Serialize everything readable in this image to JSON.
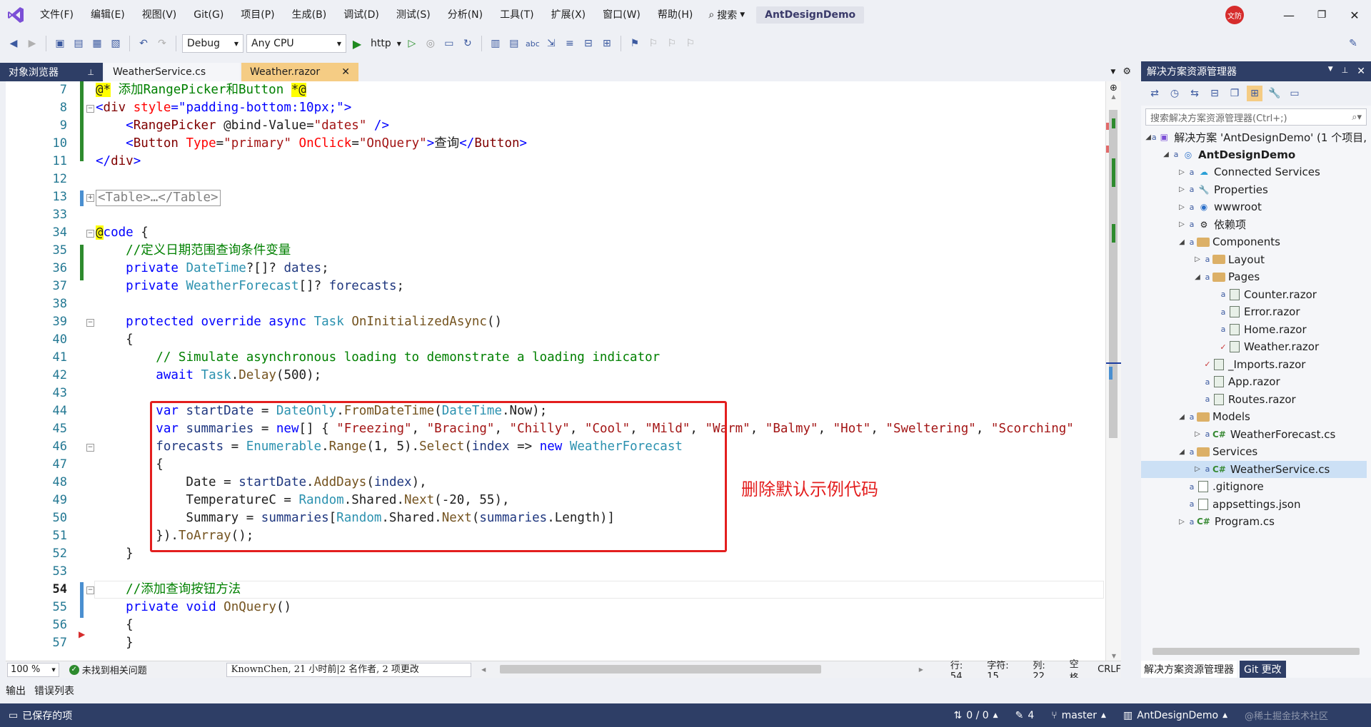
{
  "menu": {
    "items": [
      "文件(F)",
      "编辑(E)",
      "视图(V)",
      "Git(G)",
      "项目(P)",
      "生成(B)",
      "调试(D)",
      "测试(S)",
      "分析(N)",
      "工具(T)",
      "扩展(X)",
      "窗口(W)",
      "帮助(H)"
    ],
    "search_label": "搜索",
    "solution_title": "AntDesignDemo",
    "user_avatar": "文防"
  },
  "toolbar": {
    "config": "Debug",
    "platform": "Any CPU",
    "run_target": "http"
  },
  "tabs": {
    "object_browser": "对象浏览器",
    "file1": "WeatherService.cs",
    "file2": "Weather.razor"
  },
  "editor": {
    "line_numbers": [
      "7",
      "8",
      "9",
      "10",
      "11",
      "12",
      "13",
      "33",
      "34",
      "35",
      "36",
      "37",
      "38",
      "39",
      "40",
      "41",
      "42",
      "43",
      "44",
      "45",
      "46",
      "47",
      "48",
      "49",
      "50",
      "51",
      "52",
      "53",
      "54",
      "55",
      "56",
      "57"
    ],
    "current_line": "54",
    "annotation": "删除默认示例代码"
  },
  "status_line": {
    "zoom": "100 %",
    "issues": "未找到相关问题",
    "git_info": "KnownChen, 21 小时前|2 名作者, 2 项更改",
    "line": "行: 54",
    "char": "字符: 15",
    "col": "列: 22",
    "whitespace": "空格",
    "eol": "CRLF"
  },
  "solution_explorer": {
    "title": "解决方案资源管理器",
    "search_placeholder": "搜索解决方案资源管理器(Ctrl+;)",
    "items": [
      {
        "label": "解决方案 'AntDesignDemo' (1 个项目,",
        "indent": 0,
        "kind": "solution"
      },
      {
        "label": "AntDesignDemo",
        "indent": 1,
        "kind": "project"
      },
      {
        "label": "Connected Services",
        "indent": 2,
        "kind": "connected"
      },
      {
        "label": "Properties",
        "indent": 2,
        "kind": "props"
      },
      {
        "label": "wwwroot",
        "indent": 2,
        "kind": "globe"
      },
      {
        "label": "依赖项",
        "indent": 2,
        "kind": "deps"
      },
      {
        "label": "Components",
        "indent": 2,
        "kind": "folder"
      },
      {
        "label": "Layout",
        "indent": 3,
        "kind": "folder"
      },
      {
        "label": "Pages",
        "indent": 3,
        "kind": "folder"
      },
      {
        "label": "Counter.razor",
        "indent": 4,
        "kind": "razor"
      },
      {
        "label": "Error.razor",
        "indent": 4,
        "kind": "razor"
      },
      {
        "label": "Home.razor",
        "indent": 4,
        "kind": "razor"
      },
      {
        "label": "Weather.razor",
        "indent": 4,
        "kind": "razor"
      },
      {
        "label": "_Imports.razor",
        "indent": 3,
        "kind": "razor"
      },
      {
        "label": "App.razor",
        "indent": 3,
        "kind": "razor"
      },
      {
        "label": "Routes.razor",
        "indent": 3,
        "kind": "razor"
      },
      {
        "label": "Models",
        "indent": 2,
        "kind": "folder"
      },
      {
        "label": "WeatherForecast.cs",
        "indent": 3,
        "kind": "cs"
      },
      {
        "label": "Services",
        "indent": 2,
        "kind": "folder"
      },
      {
        "label": "WeatherService.cs",
        "indent": 3,
        "kind": "cs"
      },
      {
        "label": ".gitignore",
        "indent": 2,
        "kind": "file"
      },
      {
        "label": "appsettings.json",
        "indent": 2,
        "kind": "json"
      },
      {
        "label": "Program.cs",
        "indent": 2,
        "kind": "cs"
      }
    ],
    "bottom_tab_active": "解决方案资源管理器",
    "bottom_tab_git": "Git 更改"
  },
  "bottom_tabs": [
    "输出",
    "错误列表"
  ],
  "statusbar": {
    "saved": "已保存的项",
    "sync": "0 / 0",
    "edits": "4",
    "branch": "master",
    "repo": "AntDesignDemo",
    "watermark": "@稀土掘金技术社区"
  }
}
